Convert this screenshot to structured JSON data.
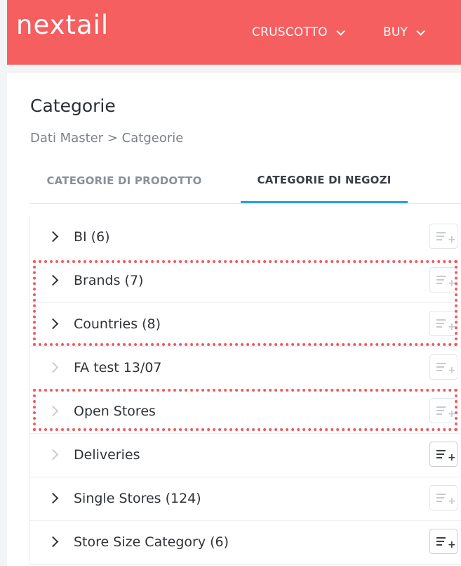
{
  "app": {
    "logo": "nextail"
  },
  "nav": {
    "items": [
      {
        "label": "CRUSCOTTO"
      },
      {
        "label": "BUY"
      }
    ]
  },
  "page": {
    "title": "Categorie",
    "breadcrumb": "Dati Master > Catgeorie"
  },
  "tabs": [
    {
      "label": "CATEGORIE DI PRODOTTO",
      "active": false
    },
    {
      "label": "CATEGORIE DI NEGOZI",
      "active": true
    }
  ],
  "categories": [
    {
      "label": "BI (6)",
      "expandable": true,
      "add_enabled": false
    },
    {
      "label": "Brands (7)",
      "expandable": true,
      "add_enabled": false
    },
    {
      "label": "Countries (8)",
      "expandable": true,
      "add_enabled": false
    },
    {
      "label": "FA test 13/07",
      "expandable": false,
      "add_enabled": false
    },
    {
      "label": "Open Stores",
      "expandable": false,
      "add_enabled": false
    },
    {
      "label": "Deliveries",
      "expandable": false,
      "add_enabled": true
    },
    {
      "label": "Single Stores (124)",
      "expandable": true,
      "add_enabled": false
    },
    {
      "label": "Store Size Category (6)",
      "expandable": true,
      "add_enabled": true
    }
  ],
  "colors": {
    "brand": "#f55f60",
    "active_tab_underline": "#2aa0d8",
    "highlight": "#f05a5f"
  },
  "icons": {
    "expand": "chevron-right-icon",
    "add": "add-to-list-icon",
    "nav_dropdown": "chevron-down-icon"
  }
}
